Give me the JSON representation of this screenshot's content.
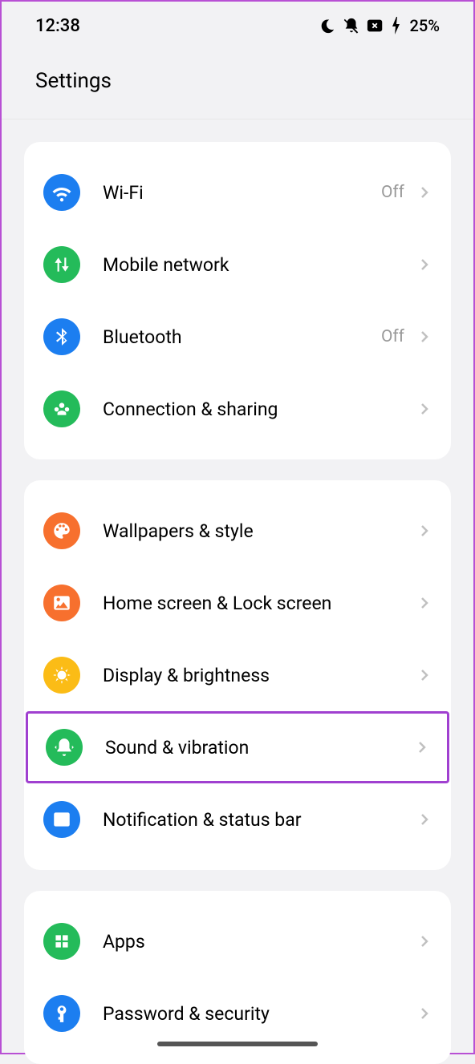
{
  "statusBar": {
    "time": "12:38",
    "battery": "25%"
  },
  "header": {
    "title": "Settings"
  },
  "groups": [
    {
      "items": [
        {
          "id": "wifi",
          "label": "Wi-Fi",
          "value": "Off",
          "icon": "wifi",
          "color": "bg-blue"
        },
        {
          "id": "mobile-network",
          "label": "Mobile network",
          "value": "",
          "icon": "mobile",
          "color": "bg-green"
        },
        {
          "id": "bluetooth",
          "label": "Bluetooth",
          "value": "Off",
          "icon": "bluetooth",
          "color": "bg-blue"
        },
        {
          "id": "connection-sharing",
          "label": "Connection & sharing",
          "value": "",
          "icon": "sharing",
          "color": "bg-green"
        }
      ]
    },
    {
      "items": [
        {
          "id": "wallpapers",
          "label": "Wallpapers & style",
          "value": "",
          "icon": "palette",
          "color": "bg-orange"
        },
        {
          "id": "home-lock",
          "label": "Home screen & Lock screen",
          "value": "",
          "icon": "image",
          "color": "bg-orange"
        },
        {
          "id": "display",
          "label": "Display & brightness",
          "value": "",
          "icon": "sun",
          "color": "bg-yellow"
        },
        {
          "id": "sound",
          "label": "Sound & vibration",
          "value": "",
          "icon": "bell",
          "color": "bg-green",
          "highlighted": true
        },
        {
          "id": "notification",
          "label": "Notification & status bar",
          "value": "",
          "icon": "notification",
          "color": "bg-blue"
        }
      ]
    },
    {
      "items": [
        {
          "id": "apps",
          "label": "Apps",
          "value": "",
          "icon": "apps",
          "color": "bg-green"
        },
        {
          "id": "password",
          "label": "Password & security",
          "value": "",
          "icon": "key",
          "color": "bg-blue"
        }
      ]
    }
  ]
}
